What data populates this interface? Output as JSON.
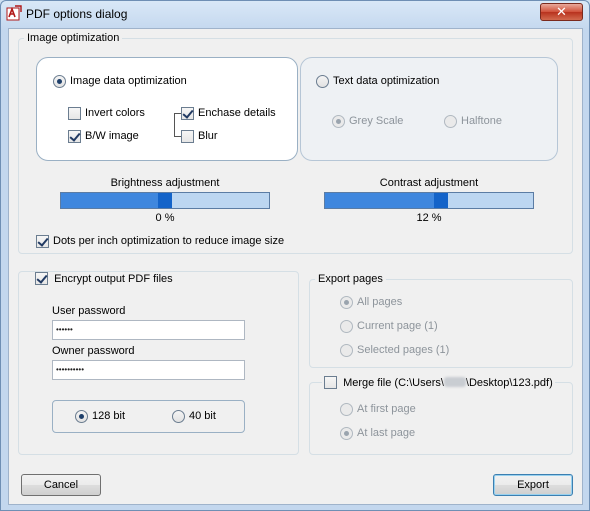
{
  "window": {
    "title": "PDF options dialog",
    "close_label": "✕"
  },
  "image_optimization": {
    "legend": "Image optimization",
    "image_data_label": "Image data optimization",
    "image_data_selected": true,
    "invert_colors_label": "Invert colors",
    "invert_colors_checked": false,
    "bw_image_label": "B/W image",
    "bw_image_checked": true,
    "enchase_details_label": "Enchase details",
    "enchase_details_checked": true,
    "blur_label": "Blur",
    "blur_checked": false,
    "text_data_label": "Text data optimization",
    "text_data_selected": false,
    "grey_scale_label": "Grey Scale",
    "grey_scale_selected": true,
    "halftone_label": "Halftone",
    "halftone_selected": false,
    "brightness_label": "Brightness adjustment",
    "brightness_value_text": "0 %",
    "brightness_fraction": 0.5,
    "contrast_label": "Contrast adjustment",
    "contrast_value_text": "12 %",
    "contrast_fraction": 0.56,
    "dpi_label": "Dots per inch optimization to reduce image size",
    "dpi_checked": true
  },
  "encryption": {
    "encrypt_label": "Encrypt output PDF files",
    "encrypt_checked": true,
    "user_password_label": "User password",
    "user_password_value": "••••••",
    "owner_password_label": "Owner password",
    "owner_password_value": "••••••••••",
    "bit128_label": "128 bit",
    "bit128_selected": true,
    "bit40_label": "40 bit",
    "bit40_selected": false
  },
  "export_pages": {
    "legend": "Export pages",
    "all_pages_label": "All pages",
    "current_page_label": "Current page (1)",
    "selected_pages_label": "Selected pages (1)",
    "selected_option": "all"
  },
  "merge": {
    "merge_label": "Merge file (C:\\Users\\",
    "merge_label_tail": "\\Desktop\\123.pdf)",
    "merge_checked": false,
    "at_first_label": "At first page",
    "at_last_label": "At last page",
    "selected_option": "last"
  },
  "buttons": {
    "cancel": "Cancel",
    "export": "Export"
  },
  "colors": {
    "slider_track": "#bcd6f1",
    "slider_fill": "#3f87de",
    "slider_thumb": "#1363c9",
    "close_button": "#c8452f"
  }
}
